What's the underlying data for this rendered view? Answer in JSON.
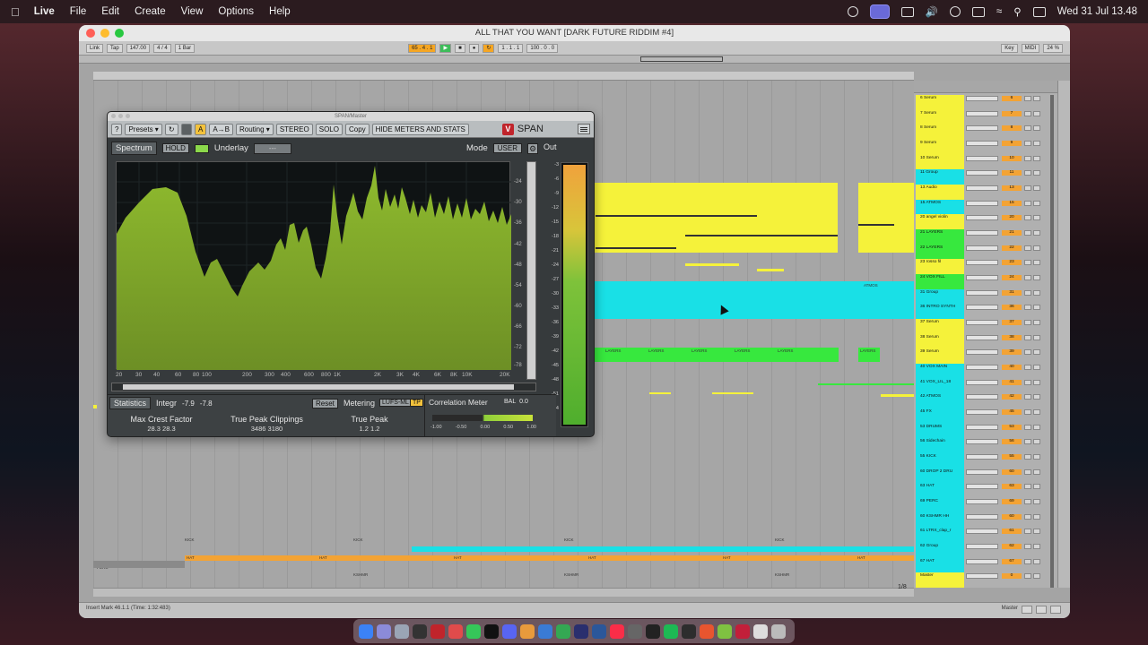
{
  "menubar": {
    "app": "Live",
    "items": [
      "File",
      "Edit",
      "Create",
      "View",
      "Options",
      "Help"
    ],
    "clock": "Wed 31 Jul  13.48"
  },
  "window": {
    "title": "ALL THAT YOU WANT  [DARK FUTURE RIDDIM #4]"
  },
  "transport": {
    "link": "Link",
    "tap": "Tap",
    "tempo": "147.00",
    "signature": "4 / 4",
    "quantize": "1 Bar",
    "position": "65 . 4 . 1",
    "loop_start": "1 . 1 . 1",
    "loop_length": "100 . 0 . 0",
    "key": "Key",
    "midi": "MIDI",
    "cpu": "24 %"
  },
  "span": {
    "window_title": "SPAN/Master",
    "help": "?",
    "presets": "Presets",
    "ab_a": "A",
    "ab_b": "A→B",
    "routing": "Routing",
    "stereo": "STEREO",
    "solo": "SOLO",
    "copy": "Copy",
    "hide_meters": "HIDE METERS AND STATS",
    "logo_mark": "V",
    "logo": "SPAN",
    "spectrum_tab": "Spectrum",
    "hold": "HOLD",
    "underlay": "Underlay",
    "underlay_value": "---",
    "mode_label": "Mode",
    "mode_value": "USER",
    "out_label": "Out",
    "db_ticks": [
      "-24",
      "-30",
      "-36",
      "-42",
      "-48",
      "-54",
      "-60",
      "-66",
      "-72",
      "-78"
    ],
    "freq_ticks": [
      "20",
      "30",
      "40",
      "60",
      "80",
      "100",
      "200",
      "300",
      "400",
      "600",
      "800",
      "1K",
      "2K",
      "3K",
      "4K",
      "6K",
      "8K",
      "10K",
      "20K"
    ],
    "out_ticks": [
      "-3",
      "-6",
      "-9",
      "-12",
      "-15",
      "-18",
      "-21",
      "-24",
      "-27",
      "-30",
      "-33",
      "-36",
      "-39",
      "-42",
      "-45",
      "-48",
      "-51",
      "-54"
    ],
    "statistics_tab": "Statistics",
    "integr_label": "Integr",
    "integr_l": "-7.9",
    "integr_r": "-7.8",
    "reset": "Reset",
    "metering": "Metering",
    "metering_mode": "LUFS-ML",
    "tp_flag": "TP",
    "max_crest_label": "Max Crest Factor",
    "max_crest_values": "28.3   28.3",
    "true_peak_clip_label": "True Peak Clippings",
    "true_peak_clip_values": "3486  3180",
    "true_peak_label": "True Peak",
    "true_peak_values": "1.2    1.2",
    "correlation_label": "Correlation Meter",
    "bal_label": "BAL",
    "bal_value": "0.0",
    "corr_ticks": [
      "-1.00",
      "-0.50",
      "0.00",
      "0.50",
      "1.00"
    ]
  },
  "tracks": [
    {
      "name": "6 Serum",
      "num": "6"
    },
    {
      "name": "7 Serum",
      "num": "7"
    },
    {
      "name": "8 Serum",
      "num": "8"
    },
    {
      "name": "9 Serum",
      "num": "9"
    },
    {
      "name": "10 Serum",
      "num": "10"
    },
    {
      "name": "11 Group",
      "num": "11"
    },
    {
      "name": "13 Audio",
      "num": "13"
    },
    {
      "name": "15 ATMOS",
      "num": "15"
    },
    {
      "name": "20 angel violin",
      "num": "20"
    },
    {
      "name": "21 LAYERS",
      "num": "21"
    },
    {
      "name": "22 LAYERS",
      "num": "22"
    },
    {
      "name": "23 rosso fil",
      "num": "23"
    },
    {
      "name": "24 VOX FILL",
      "num": "24"
    },
    {
      "name": "31 Group",
      "num": "31"
    },
    {
      "name": "36 INTRO SYNTH",
      "num": "36"
    },
    {
      "name": "37 Serum",
      "num": "37"
    },
    {
      "name": "38 Serum",
      "num": "38"
    },
    {
      "name": "39 Serum",
      "num": "39"
    },
    {
      "name": "40 VOX MAIN",
      "num": "40"
    },
    {
      "name": "41 VOX_LIL_18",
      "num": "41"
    },
    {
      "name": "42 ATMOS",
      "num": "42"
    },
    {
      "name": "45 FX",
      "num": "45"
    },
    {
      "name": "53 DRUMS",
      "num": "53"
    },
    {
      "name": "56 Sidechain",
      "num": "56"
    },
    {
      "name": "55 KICK",
      "num": "55"
    },
    {
      "name": "60 DROP 2 DRU",
      "num": "60"
    },
    {
      "name": "63 HAT",
      "num": "63"
    },
    {
      "name": "69 PERC",
      "num": "69"
    },
    {
      "name": "60 KSHMR HH",
      "num": "60"
    },
    {
      "name": "61 LTRX_clap_r",
      "num": "61"
    },
    {
      "name": "62 Group",
      "num": "62"
    },
    {
      "name": "67 HAT",
      "num": "67"
    },
    {
      "name": "Master",
      "num": "0"
    }
  ],
  "arrangement": {
    "clip_labels": {
      "layers": "LAYERS",
      "atmos": "ATMOS",
      "kick": "KICK",
      "hat": "HAT",
      "kshmr": "KSHMR",
      "perc": "PERC"
    },
    "page": "1/8"
  },
  "status": {
    "text": "Insert Mark 46.1.1 (Time: 1:32:483)",
    "master_label": "Master"
  },
  "colors": {
    "yellow_clip": "#f5f23a",
    "cyan_clip": "#19e0e6",
    "green_clip": "#37e83e",
    "orange_clip": "#f3a334",
    "spectrum_fill": "#7fa82a"
  }
}
